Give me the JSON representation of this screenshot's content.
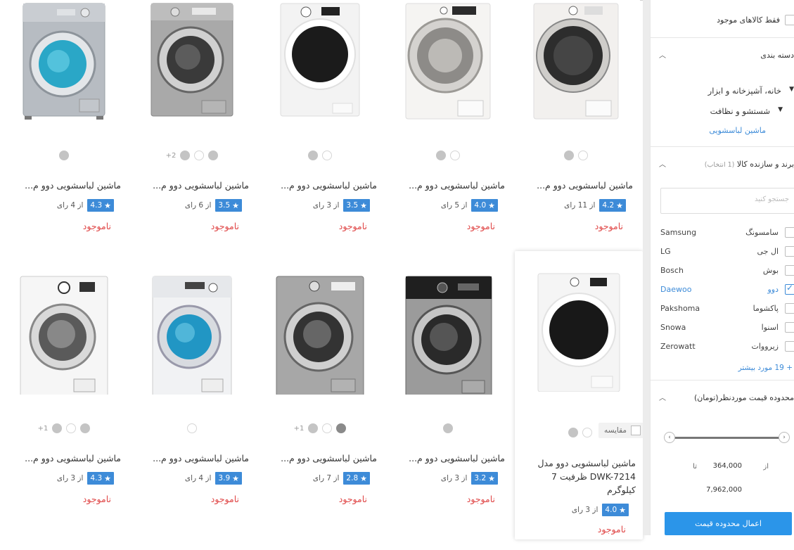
{
  "products": [
    {
      "title": "ماشین لباسشویی دوو م...",
      "rating": "4.3",
      "reviews": "از 4 رای",
      "stock": "ناموجود",
      "swatches": [
        "grey"
      ],
      "more": ""
    },
    {
      "title": "ماشین لباسشویی دوو م...",
      "rating": "3.5",
      "reviews": "از 6 رای",
      "stock": "ناموجود",
      "swatches": [
        "grey",
        "white",
        "grey"
      ],
      "more": "+2"
    },
    {
      "title": "ماشین لباسشویی دوو م...",
      "rating": "3.5",
      "reviews": "از 3 رای",
      "stock": "ناموجود",
      "swatches": [
        "grey",
        "white"
      ],
      "more": ""
    },
    {
      "title": "ماشین لباسشویی دوو م...",
      "rating": "4.0",
      "reviews": "از 5 رای",
      "stock": "ناموجود",
      "swatches": [
        "grey",
        "white"
      ],
      "more": ""
    },
    {
      "title": "ماشین لباسشویی دوو م...",
      "rating": "4.2",
      "reviews": "از 11 رای",
      "stock": "ناموجود",
      "swatches": [
        "grey",
        "white"
      ],
      "more": ""
    },
    {
      "title": "ماشین لباسشویی دوو م...",
      "rating": "4.3",
      "reviews": "از 3 رای",
      "stock": "ناموجود",
      "swatches": [
        "grey",
        "white",
        "grey"
      ],
      "more": "+1"
    },
    {
      "title": "ماشین لباسشویی دوو م...",
      "rating": "3.9",
      "reviews": "از 4 رای",
      "stock": "ناموجود",
      "swatches": [
        "white"
      ],
      "more": ""
    },
    {
      "title": "ماشین لباسشویی دوو م...",
      "rating": "2.8",
      "reviews": "از 7 رای",
      "stock": "ناموجود",
      "swatches": [
        "grey",
        "white",
        "dark"
      ],
      "more": "+1"
    },
    {
      "title": "ماشین لباسشویی دوو م...",
      "rating": "3.2",
      "reviews": "از 3 رای",
      "stock": "ناموجود",
      "swatches": [
        "grey"
      ],
      "more": ""
    },
    {
      "title": "ماشین لباسشویی دوو مدل DWK-7214 ظرفیت 7 کیلوگرم",
      "rating": "4.0",
      "reviews": "از 3 رای",
      "stock": "ناموجود",
      "swatches": [
        "grey",
        "white"
      ],
      "more": ""
    }
  ],
  "compare_label": "مقایسه",
  "sidebar": {
    "only_available": "فقط کالاهای موجود",
    "category_header": "دسته بندی",
    "cat_level1": "خانه، آشپزخانه و ابزار",
    "cat_level2": "شستشو و نظافت",
    "cat_level3": "ماشین لباسشویی",
    "brand_header": "برند و سازنده کالا",
    "brand_selected": "(1 انتخاب)",
    "brand_search_placeholder": "جستجو کنید",
    "brands": [
      {
        "en": "Samsung",
        "fa": "سامسونگ",
        "checked": false
      },
      {
        "en": "LG",
        "fa": "ال جی",
        "checked": false
      },
      {
        "en": "Bosch",
        "fa": "بوش",
        "checked": false
      },
      {
        "en": "Daewoo",
        "fa": "دوو",
        "checked": true
      },
      {
        "en": "Pakshoma",
        "fa": "پاکشوما",
        "checked": false
      },
      {
        "en": "Snowa",
        "fa": "اسنوا",
        "checked": false
      },
      {
        "en": "Zerowatt",
        "fa": "زیرووات",
        "checked": false
      }
    ],
    "more_brands": "+ 19 مورد بیشتر",
    "price_header": "محدوده قیمت موردنظر(تومان)",
    "price_from_label": "از",
    "price_from": "364,000",
    "price_to_label": "تا",
    "price_to": "7,962,000",
    "apply_button": "اعمال محدوده قیمت"
  },
  "colors": {
    "accent": "#3d8bd8",
    "stock_red": "#e04848",
    "apply_blue": "#2b95e9"
  }
}
